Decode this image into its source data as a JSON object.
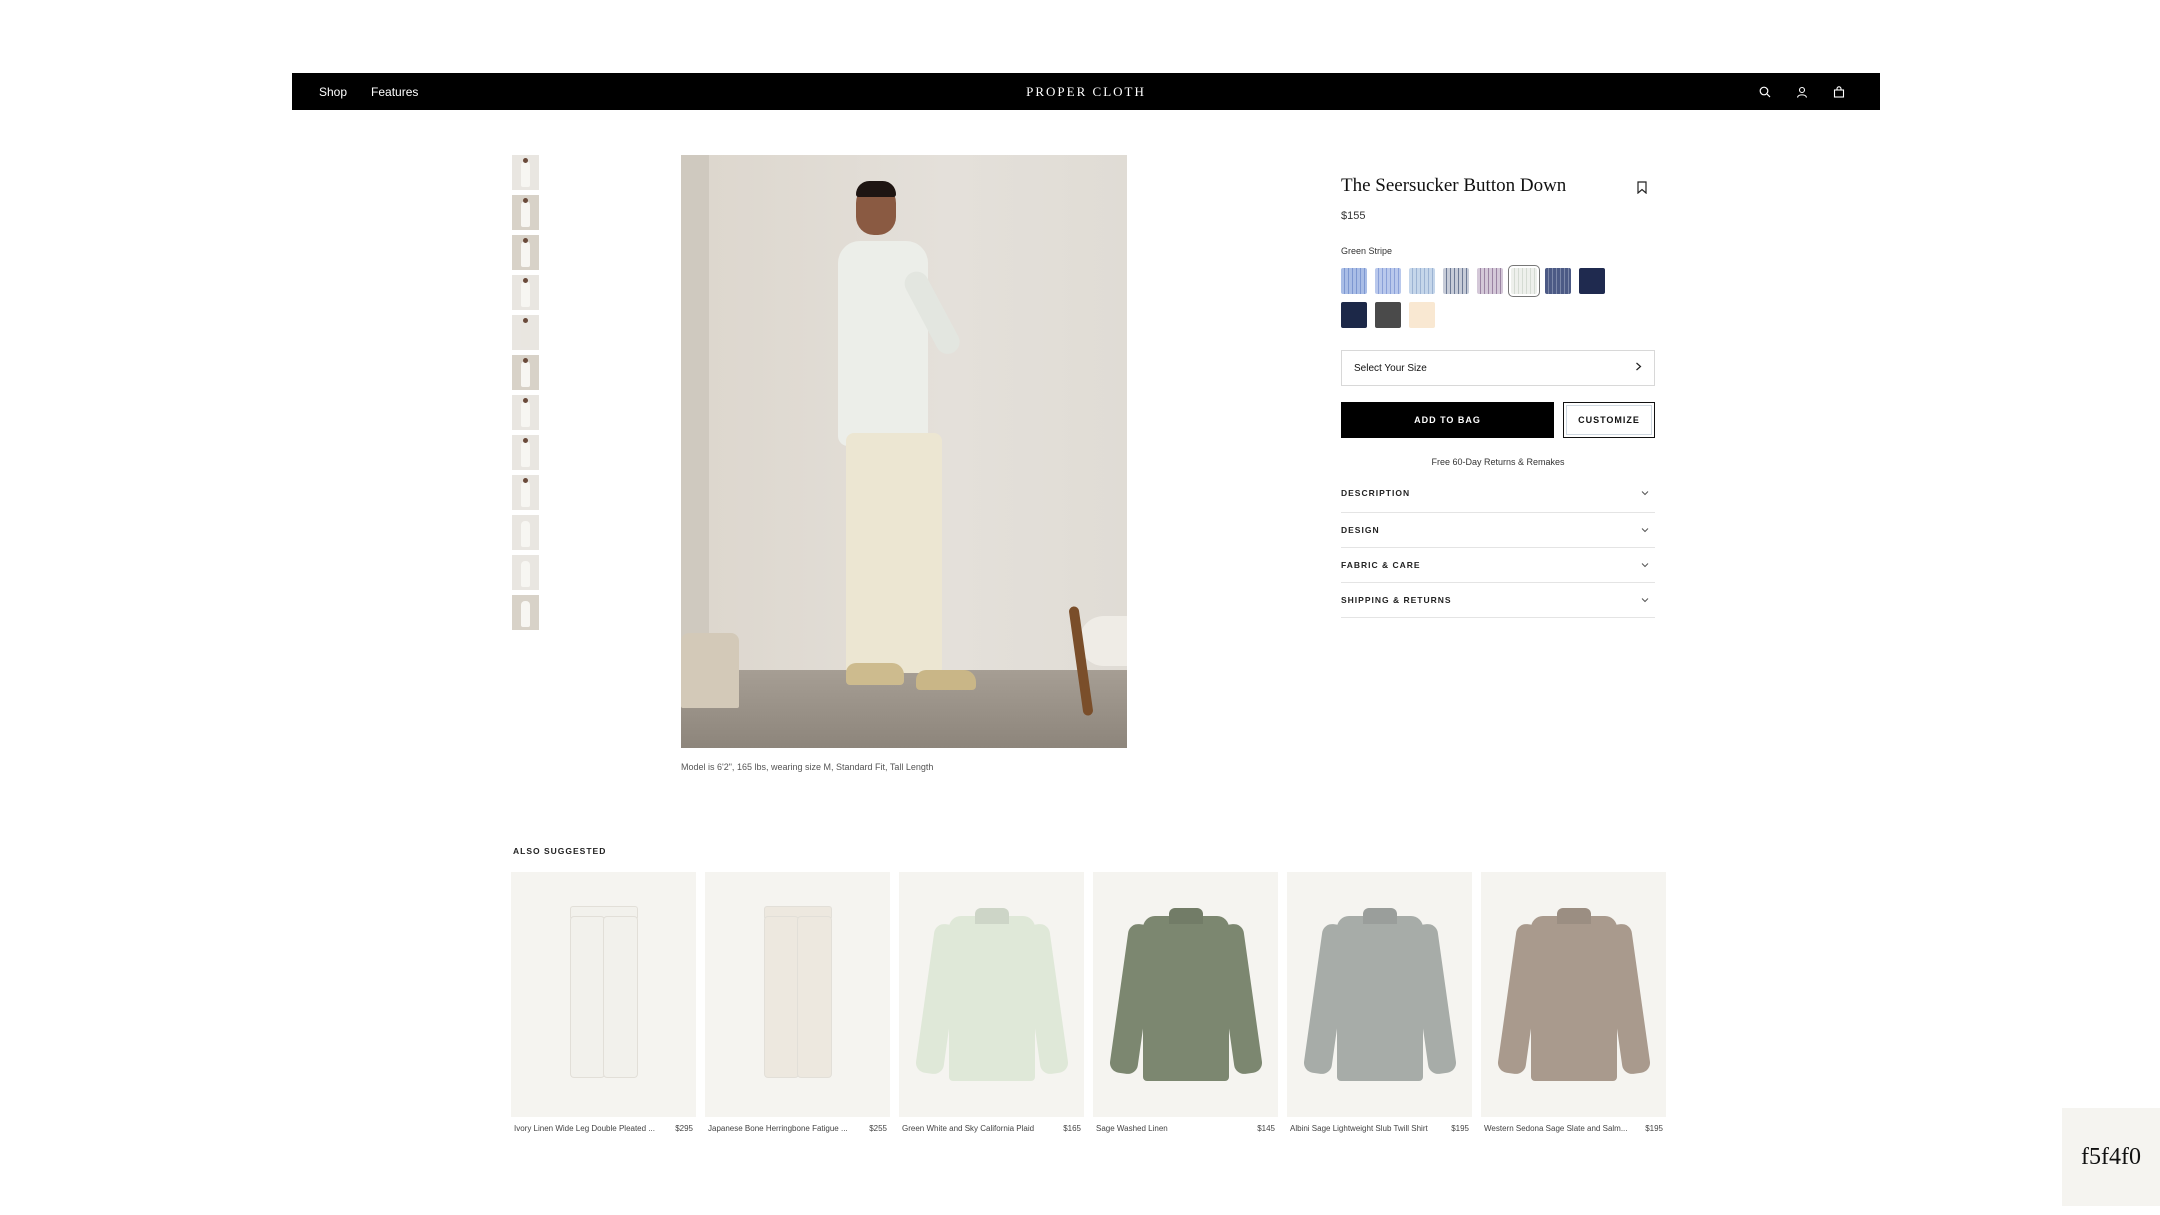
{
  "nav": {
    "links": [
      "Shop",
      "Features"
    ],
    "brand": "PROPER CLOTH",
    "icons": [
      "search-icon",
      "account-icon",
      "bag-icon"
    ]
  },
  "gallery": {
    "thumbnail_count": 12,
    "caption": "Model is 6'2\", 165 lbs, wearing size M, Standard Fit, Tall Length"
  },
  "product": {
    "title": "The Seersucker Button Down",
    "price": "$155",
    "selected_color": "Green Stripe",
    "swatches": [
      {
        "name": "blue-stripe-1",
        "color": "#a9bde6",
        "stripe": "#7d97d1"
      },
      {
        "name": "blue-stripe-2",
        "color": "#b9c8ec",
        "stripe": "#8aa0d8"
      },
      {
        "name": "sky-stripe",
        "color": "#c5d6ea",
        "stripe": "#9cb3d3"
      },
      {
        "name": "grey-blue-stripe",
        "color": "#c7ccd8",
        "stripe": "#6d7a95"
      },
      {
        "name": "purple-stripe",
        "color": "#d4c8d8",
        "stripe": "#9b84a3"
      },
      {
        "name": "green-stripe",
        "color": "#eef0ec",
        "stripe": "#d5dbd3",
        "selected": true
      },
      {
        "name": "navy-stripe",
        "color": "#4c5a85",
        "stripe": "#7b87a8"
      },
      {
        "name": "navy-1",
        "color": "#1f2a4f",
        "stripe": ""
      },
      {
        "name": "navy-2",
        "color": "#1c2848",
        "stripe": ""
      },
      {
        "name": "charcoal",
        "color": "#4a4a4a",
        "stripe": ""
      },
      {
        "name": "cream",
        "color": "#f9e8d2",
        "stripe": ""
      }
    ],
    "size_label": "Select Your Size",
    "add_to_bag": "ADD TO BAG",
    "customize": "CUSTOMIZE",
    "returns_note": "Free 60-Day Returns & Remakes",
    "accordion": [
      "DESCRIPTION",
      "DESIGN",
      "FABRIC & CARE",
      "SHIPPING & RETURNS"
    ]
  },
  "suggested": {
    "title": "ALSO SUGGESTED",
    "items": [
      {
        "name": "Ivory Linen Wide Leg Double Pleated ...",
        "price": "$295",
        "kind": "pants",
        "color": "#f2f1ec"
      },
      {
        "name": "Japanese Bone Herringbone Fatigue ...",
        "price": "$255",
        "kind": "pants",
        "color": "#ede8df"
      },
      {
        "name": "Green White and Sky California Plaid",
        "price": "$165",
        "kind": "shirt",
        "color": "#dfe8d8"
      },
      {
        "name": "Sage Washed Linen",
        "price": "$145",
        "kind": "shirt",
        "color": "#7c8770"
      },
      {
        "name": "Albini Sage Lightweight Slub Twill Shirt",
        "price": "$195",
        "kind": "shirt",
        "color": "#a7aca8"
      },
      {
        "name": "Western Sedona Sage Slate and Salm...",
        "price": "$195",
        "kind": "shirt",
        "color": "#a99a8d"
      }
    ]
  },
  "corner_tag": "f5f4f0"
}
